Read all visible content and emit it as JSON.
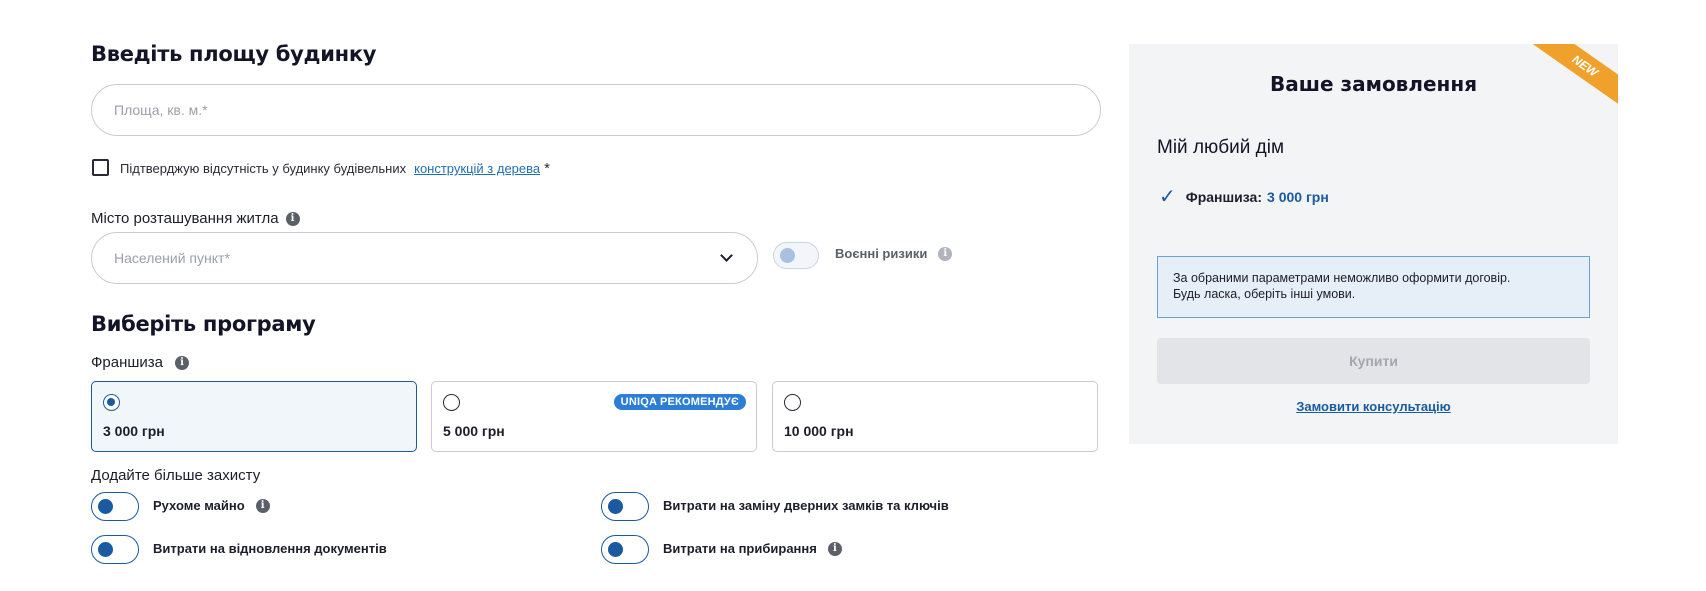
{
  "area": {
    "heading": "Введіть площу будинку",
    "placeholder": "Площа, кв. м.*"
  },
  "wood_confirm": {
    "text": "Підтверджую відсутність у будинку будівельних",
    "link": "конструкцій з дерева",
    "required": "*"
  },
  "city": {
    "label": "Місто розташування житла",
    "placeholder": "Населений пункт*",
    "war_risks_label": "Воєнні ризики"
  },
  "program": {
    "heading": "Виберіть програму",
    "franchise_label": "Франшиза",
    "options": [
      {
        "value": "3 000 грн",
        "selected": true
      },
      {
        "value": "5 000 грн",
        "selected": false,
        "badge": "UNIQA РЕКОМЕНДУЄ"
      },
      {
        "value": "10 000 грн",
        "selected": false
      }
    ]
  },
  "addons": {
    "heading": "Додайте більше захисту",
    "items": [
      {
        "label": "Рухоме майно",
        "enabled": true,
        "info": true
      },
      {
        "label": "Витрати на заміну дверних замків та ключів",
        "enabled": true,
        "info": false
      },
      {
        "label": "Витрати на відновлення документів",
        "enabled": true,
        "info": false
      },
      {
        "label": "Витрати на прибирання",
        "enabled": true,
        "info": true
      }
    ]
  },
  "order": {
    "ribbon": "NEW",
    "title": "Ваше замовлення",
    "product": "Мій любий дім",
    "franchise_key": "Франшиза:",
    "franchise_value": "3 000 грн",
    "notice_line1": "За обраними параметрами неможливо оформити договір.",
    "notice_line2": "Будь ласка, оберіть інші умови.",
    "buy_label": "Купити",
    "consult_label": "Замовити консультацію"
  },
  "colors": {
    "accent": "#1a5aa0",
    "badge": "#2b7dd6",
    "ribbon": "#f0a12b"
  }
}
